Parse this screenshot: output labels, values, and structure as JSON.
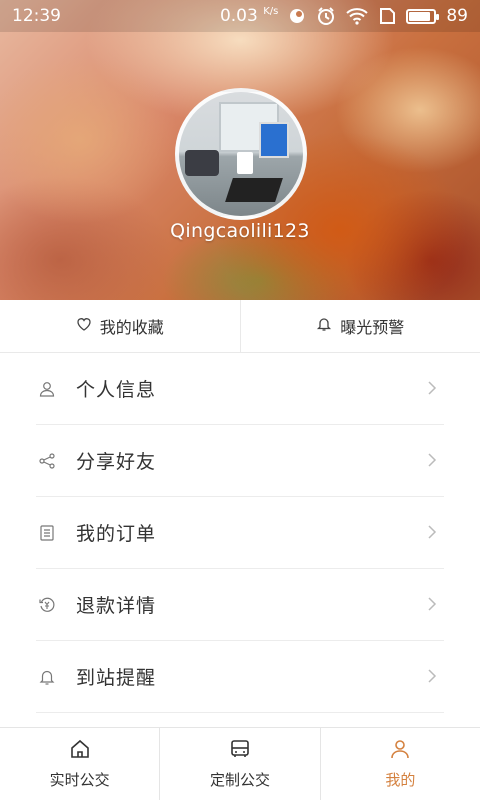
{
  "status_bar": {
    "time": "12:39",
    "network_speed": "0.03",
    "network_unit": "K/s",
    "battery": "89",
    "battery_level": 0.89
  },
  "profile": {
    "username": "Qingcaolili123"
  },
  "quick_actions": [
    {
      "label": "我的收藏",
      "icon": "heart-icon"
    },
    {
      "label": "曝光预警",
      "icon": "bell-icon"
    }
  ],
  "menu": [
    {
      "label": "个人信息",
      "icon": "user-icon"
    },
    {
      "label": "分享好友",
      "icon": "share-icon"
    },
    {
      "label": "我的订单",
      "icon": "order-icon"
    },
    {
      "label": "退款详情",
      "icon": "refund-icon"
    },
    {
      "label": "到站提醒",
      "icon": "bell-icon"
    }
  ],
  "bottom_nav": [
    {
      "label": "实时公交",
      "icon": "home-icon",
      "active": false
    },
    {
      "label": "定制公交",
      "icon": "bus-icon",
      "active": false
    },
    {
      "label": "我的",
      "icon": "person-icon",
      "active": true
    }
  ],
  "colors": {
    "accent": "#d4813f",
    "text": "#333333",
    "divider": "#ececec"
  }
}
